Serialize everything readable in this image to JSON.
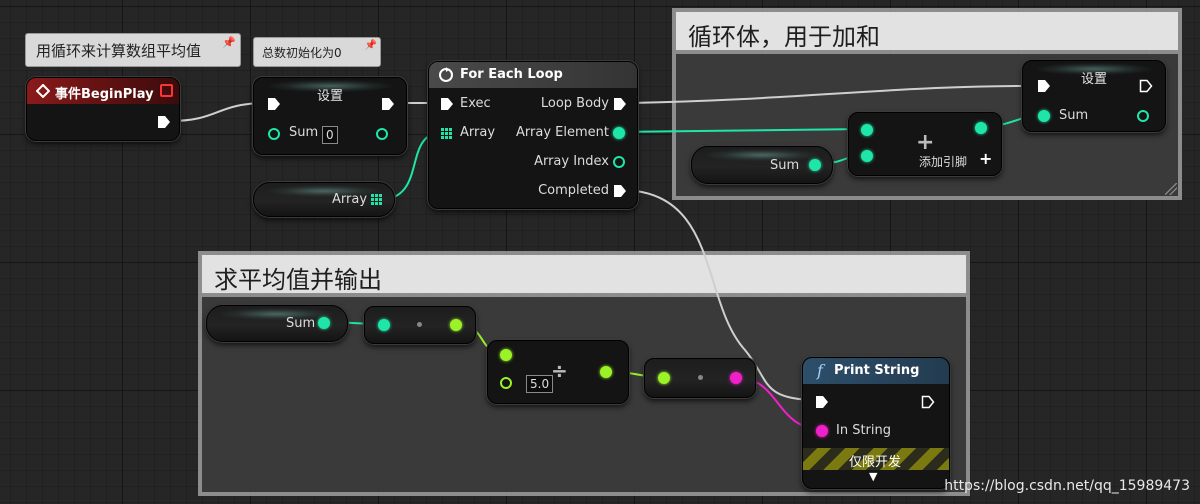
{
  "comments": {
    "loop_body": {
      "title": "循环体，用于加和"
    },
    "average": {
      "title": "求平均值并输出"
    }
  },
  "tooltips": {
    "main": "用循环来计算数组平均值",
    "init": "总数初始化为0"
  },
  "nodes": {
    "begin_play": {
      "title": "事件BeginPlay"
    },
    "set_init": {
      "title": "设置",
      "var_label": "Sum",
      "value": "0"
    },
    "array_getter": {
      "label": "Array"
    },
    "for_each": {
      "title": "For Each Loop",
      "exec_in": "Exec",
      "array_in": "Array",
      "loop_body": "Loop Body",
      "array_element": "Array Element",
      "array_index": "Array Index",
      "completed": "Completed"
    },
    "sum_getter_loop": {
      "label": "Sum"
    },
    "add_node": {
      "label": "添加引脚",
      "plus": "+"
    },
    "set_loop": {
      "title": "设置",
      "var_label": "Sum"
    },
    "sum_getter_avg": {
      "label": "Sum"
    },
    "divide": {
      "symbol": "÷",
      "value": "5.0"
    },
    "print_string": {
      "title": "Print String",
      "in_string": "In String",
      "dev_only": "仅限开发"
    }
  },
  "watermark": "https://blog.csdn.net/qq_15989473",
  "colors": {
    "exec": "#ffffff",
    "int_pin": "#1ee6a8",
    "float_pin": "#9bf227",
    "string_pin": "#f020c8",
    "event_header": "#8a1a1a",
    "print_header": "#2d4f6a"
  }
}
